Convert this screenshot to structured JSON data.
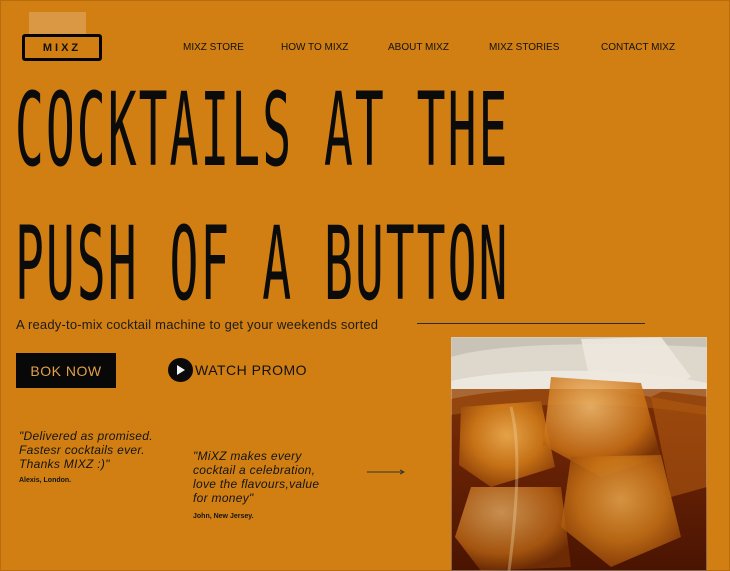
{
  "brand": {
    "logo_text": "MIXZ"
  },
  "nav": {
    "items": [
      "MIXZ STORE",
      "HOW TO MIXZ",
      "ABOUT MIXZ",
      "MIXZ STORIES",
      "CONTACT MIXZ"
    ]
  },
  "hero": {
    "line1": "COCKTAILS AT THE",
    "line2": "PUSH OF A BUTTON",
    "tagline": "A ready-to-mix cocktail machine to get your weekends sorted"
  },
  "cta": {
    "book_label": "BOK NOW",
    "watch_label": "WATCH PROMO"
  },
  "testimonials": [
    {
      "quote": "\"Delivered as promised. Fastesr cocktails ever.  Thanks MIXZ :)\"",
      "author": "Alexis, London."
    },
    {
      "quote": "\"MiXZ makes every cocktail a celebration, love the flavours,value for money\"",
      "author": "John, New Jersey."
    }
  ],
  "colors": {
    "background": "#d17f12",
    "text": "#111111",
    "button_text": "#e2a047"
  }
}
